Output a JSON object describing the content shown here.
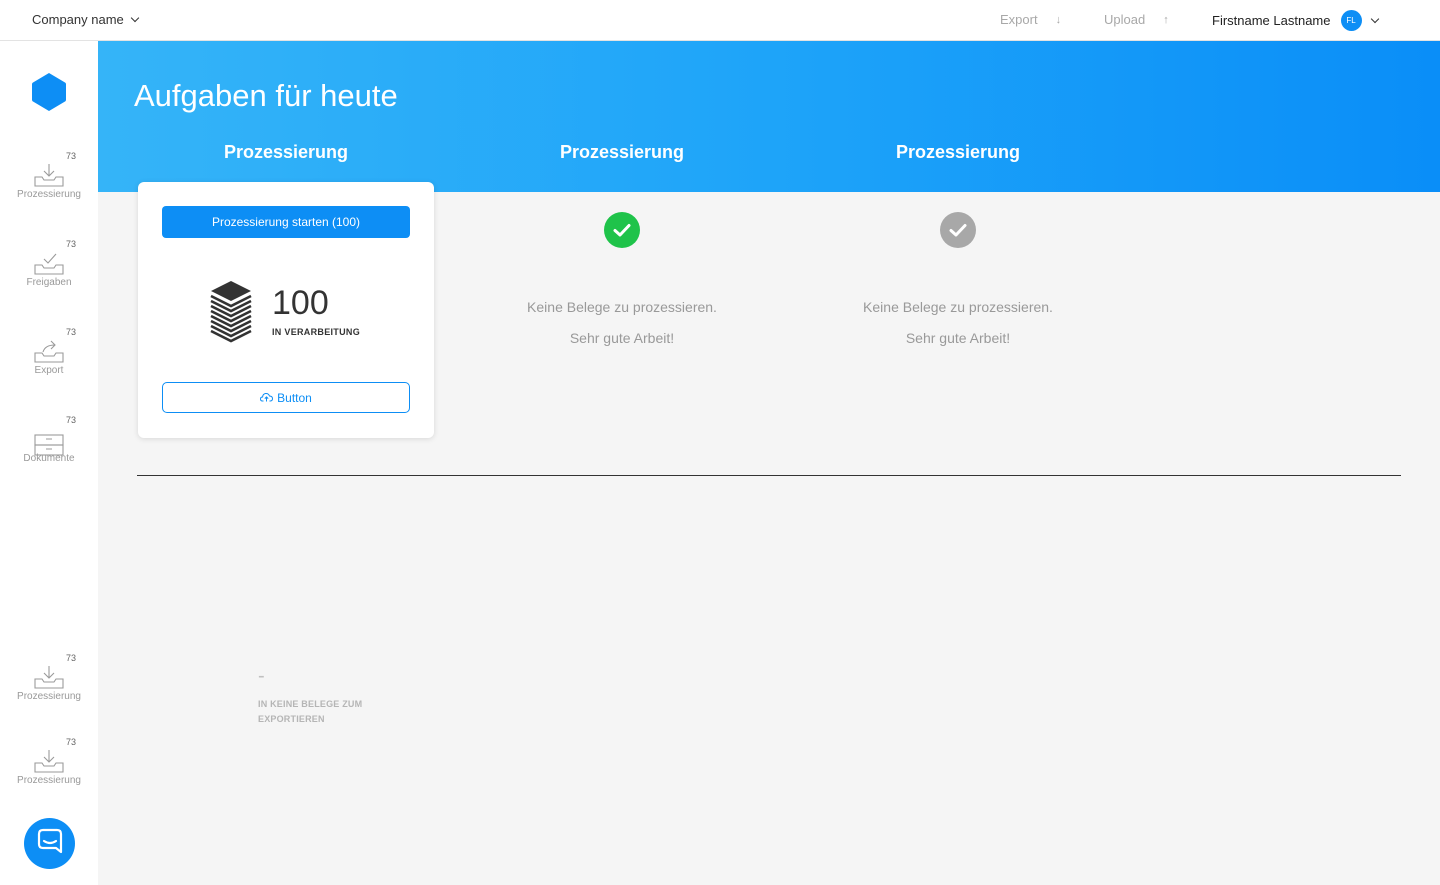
{
  "topbar": {
    "company": "Company name",
    "export_label": "Export",
    "export_arrow": "↓",
    "upload_label": "Upload",
    "upload_arrow": "↑",
    "user_name": "Firstname Lastname",
    "user_initials": "FL"
  },
  "sidebar": {
    "items": [
      {
        "label": "Prozessierung",
        "count": "73",
        "icon": "inbox-download-icon"
      },
      {
        "label": "Freigaben",
        "count": "73",
        "icon": "inbox-check-icon"
      },
      {
        "label": "Export",
        "count": "73",
        "icon": "inbox-export-icon"
      },
      {
        "label": "Dokumente",
        "count": "73",
        "icon": "drawer-icon"
      }
    ],
    "bottom_items": [
      {
        "label": "Prozessierung",
        "count": "73",
        "icon": "inbox-download-icon"
      },
      {
        "label": "Prozessierung",
        "count": "73",
        "icon": "inbox-download-icon"
      }
    ]
  },
  "hero": {
    "title": "Aufgaben für heute",
    "columns": [
      "Prozessierung",
      "Prozessierung",
      "Prozessierung"
    ]
  },
  "card": {
    "primary_button": "Prozessierung starten (100)",
    "count": "100",
    "count_label": "IN VERARBEITUNG",
    "secondary_button": "Button"
  },
  "status": [
    {
      "state": "done",
      "color": "#1fc34a",
      "line1": "Keine Belege zu prozessieren.",
      "line2": "Sehr gute Arbeit!"
    },
    {
      "state": "inactive",
      "color": "#a8a8a8",
      "line1": "Keine Belege zu prozessieren.",
      "line2": "Sehr gute Arbeit!"
    }
  ],
  "export_summary": {
    "value": "-",
    "label": "IN KEINE BELEGE ZUM EXPORTIEREN"
  },
  "colors": {
    "accent": "#0d8ef5",
    "success": "#1fc34a",
    "muted": "#a8a8a8"
  }
}
